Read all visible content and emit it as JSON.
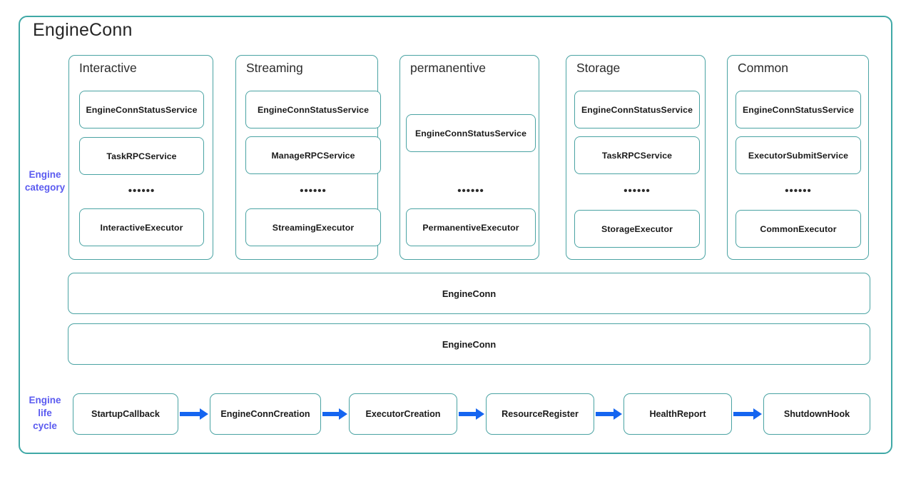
{
  "diagram": {
    "title": "EngineConn",
    "side_labels": {
      "engine_category": "Engine\ncategory",
      "engine_category_line1": "Engine",
      "engine_category_line2": "category",
      "engine_lifecycle_line1": "Engine",
      "engine_lifecycle_line2": "life",
      "engine_lifecycle_line3": "cycle"
    },
    "ellipsis": "••••••",
    "colors": {
      "border_teal": "#4aa3a3",
      "frame_teal": "#3fa8a6",
      "label_blue": "#5b5bf0",
      "arrow_blue": "#1565f0",
      "text_dark": "#1a1a1a",
      "background": "#ffffff"
    },
    "categories": [
      {
        "name": "Interactive",
        "services": [
          "EngineConnStatusService",
          "TaskRPCService"
        ],
        "executor": "InteractiveExecutor"
      },
      {
        "name": "Streaming",
        "services": [
          "EngineConnStatusService",
          "ManageRPCService"
        ],
        "executor": "StreamingExecutor"
      },
      {
        "name": "permanentive",
        "services": [
          "EngineConnStatusService"
        ],
        "executor": "PermanentiveExecutor"
      },
      {
        "name": "Storage",
        "services": [
          "EngineConnStatusService",
          "TaskRPCService"
        ],
        "executor": "StorageExecutor"
      },
      {
        "name": "Common",
        "services": [
          "EngineConnStatusService",
          "ExecutorSubmitService"
        ],
        "executor": "CommonExecutor"
      }
    ],
    "bars": [
      {
        "label": "EngineConn"
      },
      {
        "label": "EngineConn"
      }
    ],
    "lifecycle": [
      {
        "label": "StartupCallback"
      },
      {
        "label": "EngineConnCreation"
      },
      {
        "label": "ExecutorCreation"
      },
      {
        "label": "ResourceRegister"
      },
      {
        "label": "HealthReport"
      },
      {
        "label": "ShutdownHook"
      }
    ]
  }
}
